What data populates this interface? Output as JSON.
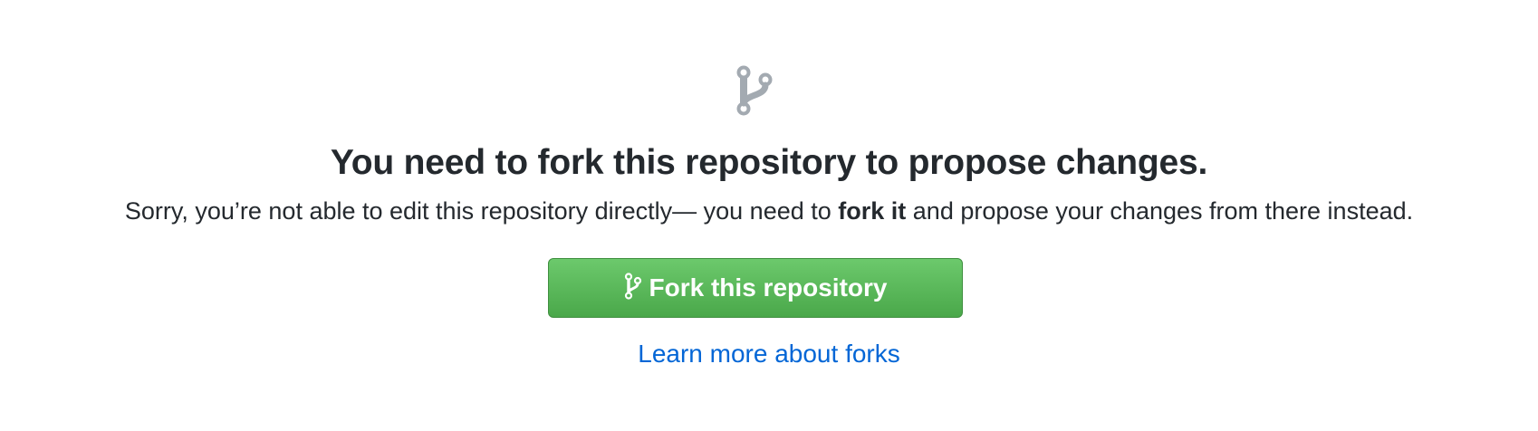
{
  "blankslate": {
    "icon": "repo-forked-icon",
    "headline": "You need to fork this repository to propose changes.",
    "description_before": "Sorry, you’re not able to edit this repository directly— you need to ",
    "description_bold": "fork it",
    "description_after": " and propose your changes from there instead.",
    "fork_button": {
      "icon": "repo-forked-icon",
      "label": "Fork this repository"
    },
    "learn_more_link": "Learn more about forks"
  },
  "colors": {
    "button_green_top": "#6cc96c",
    "button_green_bottom": "#4aa84a",
    "link_blue": "#0366d6",
    "icon_gray": "#a3aab1",
    "text_dark": "#24292e"
  }
}
